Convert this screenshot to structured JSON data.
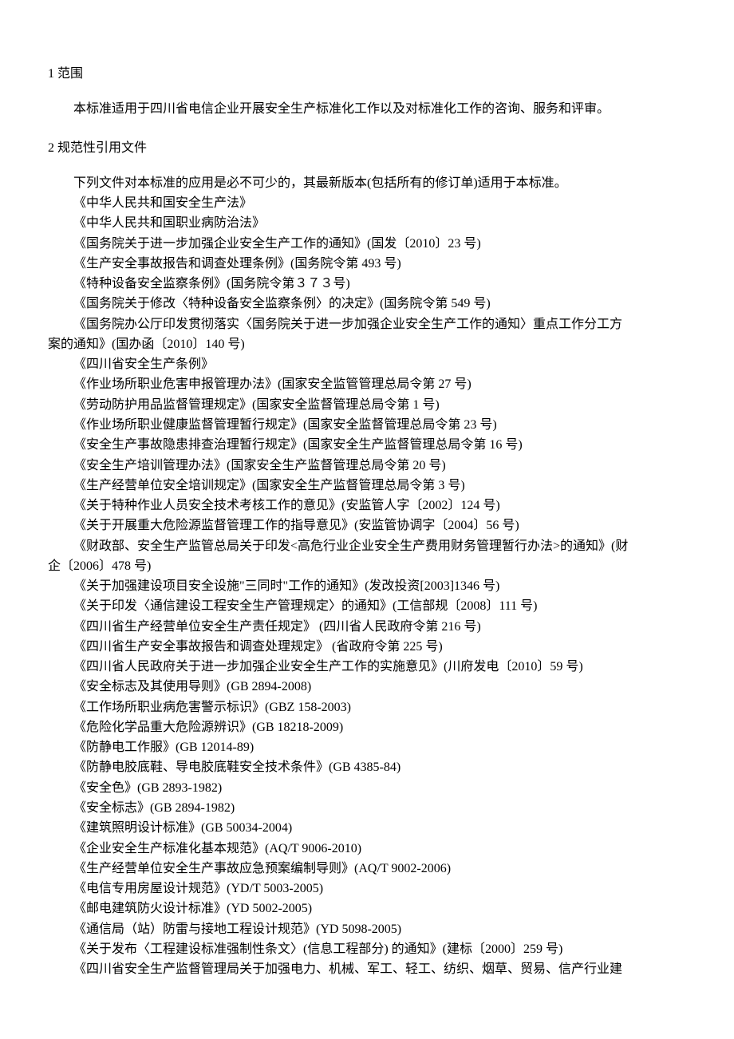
{
  "section1": {
    "heading": "1  范围",
    "body": "本标准适用于四川省电信企业开展安全生产标准化工作以及对标准化工作的咨询、服务和评审。"
  },
  "section2": {
    "heading": "2  规范性引用文件",
    "intro": "下列文件对本标准的应用是必不可少的，其最新版本(包括所有的修订单)适用于本标准。",
    "refs": [
      "《中华人民共和国安全生产法》",
      "《中华人民共和国职业病防治法》",
      "《国务院关于进一步加强企业安全生产工作的通知》(国发〔2010〕23 号)",
      "《生产安全事故报告和调查处理条例》(国务院令第 493 号)",
      "《特种设备安全监察条例》(国务院令第３７３号)",
      "《国务院关于修改〈特种设备安全监察条例〉的决定》(国务院令第 549 号)"
    ],
    "ref_wrap_a": "《国务院办公厅印发贯彻落实〈国务院关于进一步加强企业安全生产工作的通知〉重点工作分工方",
    "ref_wrap_b": "案的通知》(国办函〔2010〕140 号)",
    "refs2": [
      "《四川省安全生产条例》",
      "《作业场所职业危害申报管理办法》(国家安全监管管理总局令第 27 号)",
      "《劳动防护用品监督管理规定》(国家安全监督管理总局令第 1 号)",
      "《作业场所职业健康监督管理暂行规定》(国家安全监督管理总局令第 23 号)",
      "《安全生产事故隐患排查治理暂行规定》(国家安全生产监督管理总局令第 16 号)",
      "《安全生产培训管理办法》(国家安全生产监督管理总局令第 20 号)",
      "《生产经营单位安全培训规定》(国家安全生产监督管理总局令第 3 号)",
      "《关于特种作业人员安全技术考核工作的意见》(安监管人字〔2002〕124 号)",
      "《关于开展重大危险源监督管理工作的指导意见》(安监管协调字〔2004〕56 号)"
    ],
    "ref_wrap2_a": "《财政部、安全生产监管总局关于印发<高危行业企业安全生产费用财务管理暂行办法>的通知》(财",
    "ref_wrap2_b": "企〔2006〕478  号)",
    "refs3": [
      "《关于加强建设项目安全设施\"三同时\"工作的通知》(发改投资[2003]1346 号)",
      "《关于印发〈通信建设工程安全生产管理规定〉的通知》(工信部规〔2008〕111 号)",
      "《四川省生产经营单位安全生产责任规定》  (四川省人民政府令第 216 号)",
      "《四川省生产安全事故报告和调查处理规定》  (省政府令第 225 号)",
      "《四川省人民政府关于进一步加强企业安全生产工作的实施意见》(川府发电〔2010〕59 号)",
      "《安全标志及其使用导则》(GB 2894-2008)",
      "《工作场所职业病危害警示标识》(GBZ 158-2003)",
      "《危险化学品重大危险源辨识》(GB 18218-2009)",
      "《防静电工作服》(GB 12014-89)",
      "《防静电胶底鞋、导电胶底鞋安全技术条件》(GB 4385-84)",
      "《安全色》(GB 2893-1982)",
      "《安全标志》(GB 2894-1982)",
      "《建筑照明设计标准》(GB 50034-2004)",
      "《企业安全生产标准化基本规范》(AQ/T 9006-2010)",
      "《生产经营单位安全生产事故应急预案编制导则》(AQ/T 9002-2006)",
      "《电信专用房屋设计规范》(YD/T 5003-2005)",
      "《邮电建筑防火设计标准》(YD 5002-2005)",
      "《通信局（站）防雷与接地工程设计规范》(YD 5098-2005)",
      "《关于发布〈工程建设标准强制性条文〉(信息工程部分) 的通知》(建标〔2000〕259 号)",
      "《四川省安全生产监督管理局关于加强电力、机械、军工、轻工、纺织、烟草、贸易、信产行业建"
    ]
  }
}
